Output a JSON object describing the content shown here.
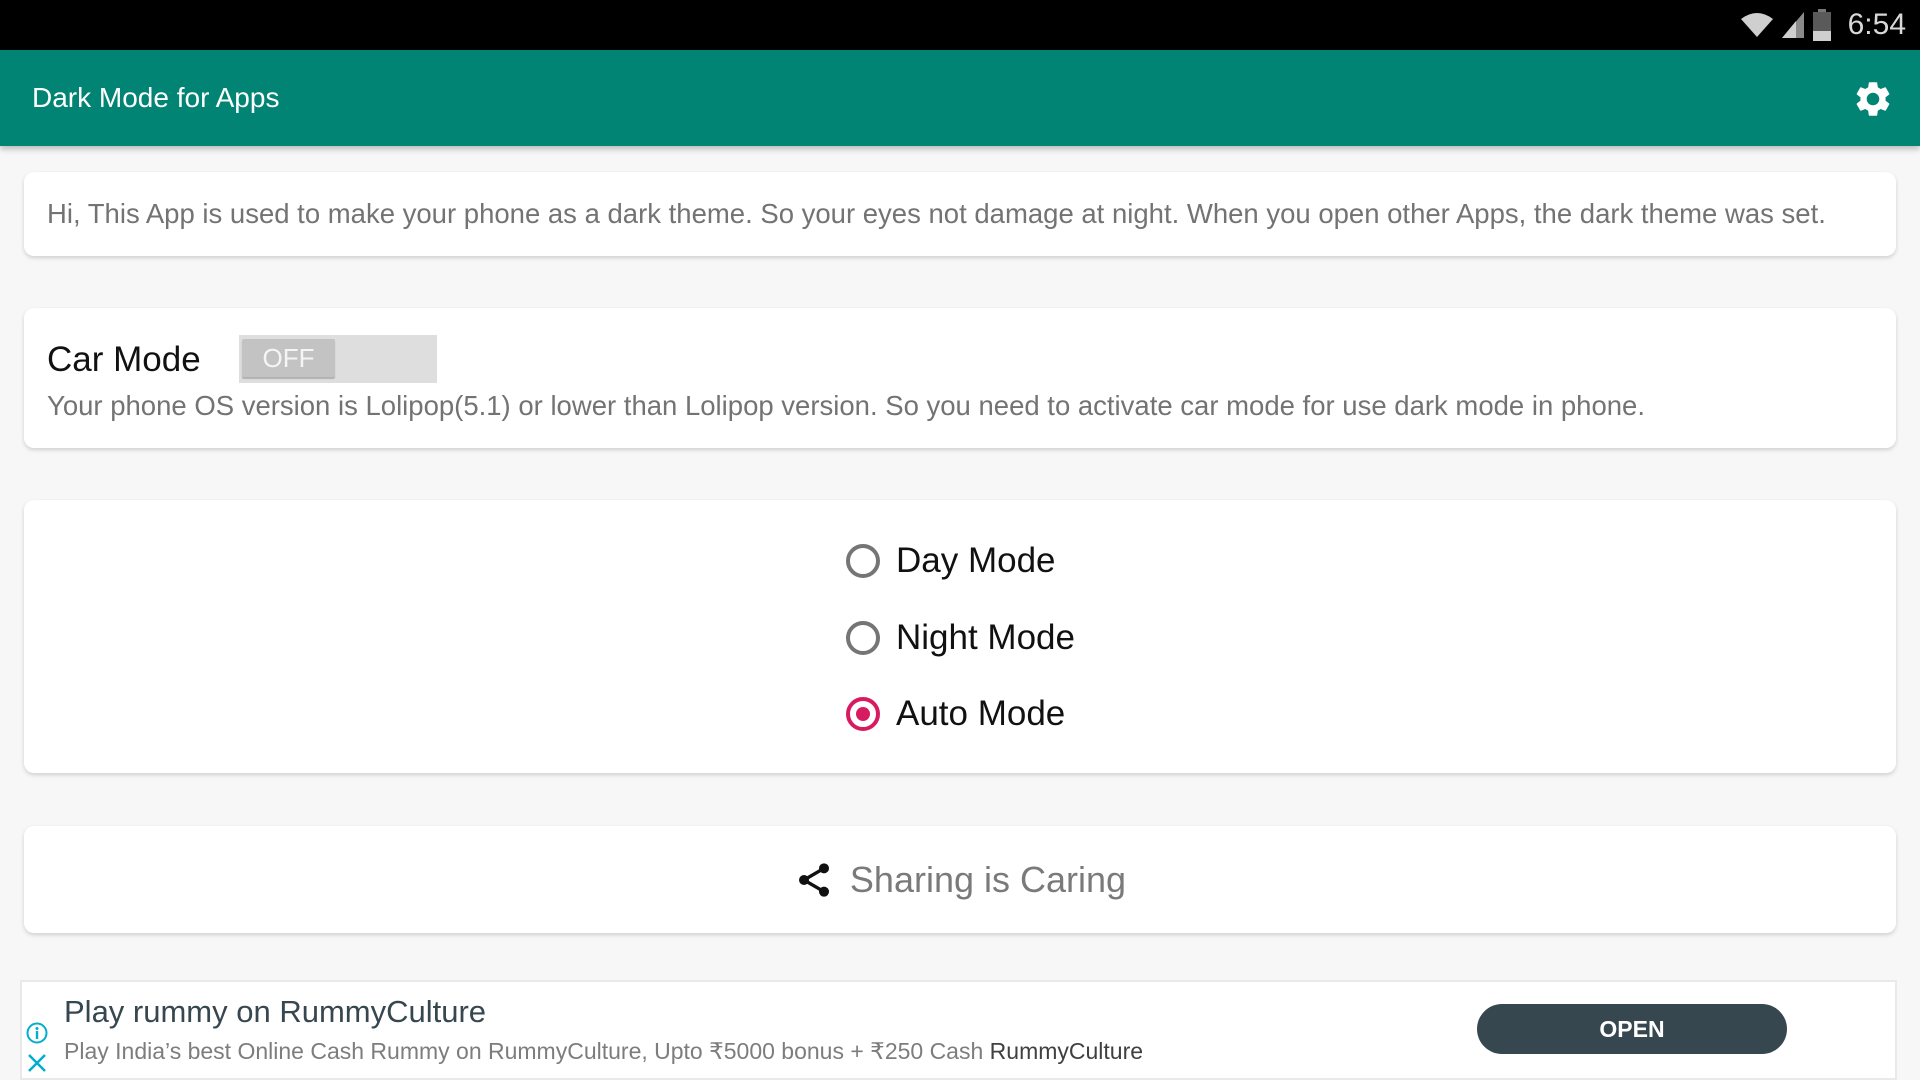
{
  "status_bar": {
    "time": "6:54",
    "icons": [
      "wifi-icon",
      "cell-signal-icon",
      "battery-icon"
    ]
  },
  "app_bar": {
    "title": "Dark Mode for Apps",
    "settings_icon": "gear-icon"
  },
  "intro": {
    "text": "Hi, This App is used to make your phone as a dark theme. So your eyes not damage at night. When you open other Apps, the dark theme was set."
  },
  "car_mode": {
    "label": "Car Mode",
    "toggle_state": "OFF",
    "description": "Your phone OS version is Lolipop(5.1) or lower than Lolipop version. So you need to activate car mode for use dark mode in phone."
  },
  "modes": {
    "options": [
      {
        "label": "Day Mode",
        "checked": false
      },
      {
        "label": "Night Mode",
        "checked": false
      },
      {
        "label": "Auto Mode",
        "checked": true
      }
    ],
    "accent_color": "#D81B60"
  },
  "share": {
    "label": "Sharing is Caring",
    "icon": "share-icon"
  },
  "ad": {
    "title": "Play rummy on RummyCulture",
    "description": "Play India’s best Online Cash Rummy on RummyCulture, Upto ₹5000 bonus + ₹250 Cash",
    "brand": "RummyCulture",
    "button_label": "OPEN"
  },
  "colors": {
    "primary": "#028474",
    "accent": "#D81B60",
    "ad_button": "#37474F",
    "ad_icon": "#00AECD"
  }
}
